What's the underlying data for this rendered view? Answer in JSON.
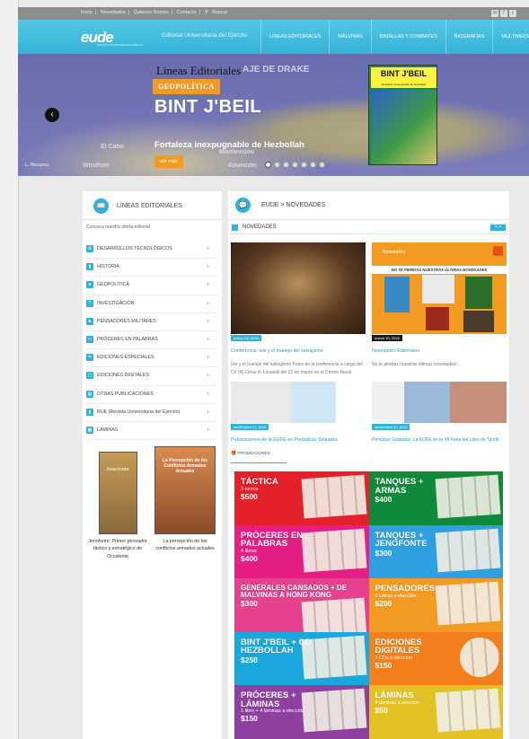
{
  "topbar": {
    "links": [
      "Inicio",
      "|",
      "Novedades",
      "|",
      "Quienes Somos",
      "|",
      "Contacto",
      "|",
      "Buscar"
    ],
    "social": [
      "✉",
      "f",
      "t"
    ]
  },
  "header": {
    "logo_text": "eude",
    "logo_sub": "EDITORIAL UNIVERSITARIA DEL EJÉRCITO",
    "brand": "Editorial Universitaria del Ejército",
    "nav": [
      "LÍNEAS EDITORIALES",
      "MALVINAS",
      "BATALLAS Y COMBATES",
      "BIOGRAFÍAS",
      "MULTIMEDIA"
    ]
  },
  "slider": {
    "heading": "Lineas Editoriales",
    "category": "GEOPOLÍTICA",
    "title": "BINT J'BEIL",
    "subtitle": "Fortaleza inexpugnable de Hezbollah",
    "button": "ver más",
    "map_labels": [
      "AJE DE DRAKE",
      "El Cabo",
      "Montevideo",
      "Asunción",
      "L. Marquez",
      "Windhoe"
    ],
    "cover_title": "BINT J'BEIL",
    "cover_sub": "Fortaleza inexpugnable de Hezbollah",
    "dots": 7,
    "active_dot": 0
  },
  "left": {
    "title": "LÍNEAS EDITORIALES",
    "intro": "Conozca nuestra oferta editorial",
    "items": [
      {
        "label": "DESARROLLOS TECNOLÓGICOS",
        "icon": "⚙"
      },
      {
        "label": "HISTORIA",
        "icon": "▮"
      },
      {
        "label": "GEOPOLÍTICA",
        "icon": "●"
      },
      {
        "label": "INVESTIGACIÓN",
        "icon": "?"
      },
      {
        "label": "PENSADORES MILITARES",
        "icon": "♞"
      },
      {
        "label": "PRÓCERES EN PALABRAS",
        "icon": "▭"
      },
      {
        "label": "EDICIONES ESPECIALES",
        "icon": "✎"
      },
      {
        "label": "EDICIONES DIGITALES",
        "icon": "▢"
      },
      {
        "label": "OTRAS PUBLICACIONES",
        "icon": "▤"
      },
      {
        "label": "RUE (Revista Universitaria del Ejército)",
        "icon": "▮"
      },
      {
        "label": "LÁMINAS",
        "icon": "▦"
      }
    ],
    "books": [
      {
        "cover": "Jenofonte",
        "caption": "Jenofonte: Primer pensador táctico y estratégico de Occidente"
      },
      {
        "cover": "La Percepción de los Conflictos Armados Actuales",
        "caption": "La percepción de los conflictos armados actuales"
      }
    ]
  },
  "right": {
    "title": "EUDE > NOVEDADES",
    "section": "NOVEDADES",
    "news_nav": "< >",
    "cards": [
      {
        "date": "marzo 24, 2016",
        "title": "Conferencia: Isis y el manejo del salvajismo",
        "text": "Isis y el manejo del salvajismo Fotos de la conferencia a cargo del Crl (R) Omar A. Locatelli del 22 de marzo en el Centro Naval."
      },
      {
        "date": "marzo 30, 2016",
        "title": "Novedades Editoriales",
        "text": "No te pierdas nuestras últimas novedades!...",
        "banner": "NO TE PIERDAS NUESTRAS ÚLTIMAS NOVEDADES",
        "banner_small": "Novedades",
        "footer": "UNIVERSITARIA DEL EJÉRCITO ARGENTINO"
      },
      {
        "date": "septiembre 21, 2015",
        "title": "Publicaciones de la EUDE en Periódicos Soldados",
        "text": ""
      },
      {
        "date": "septiembre 21, 2015",
        "title": "Periódico Soldados: La EUDE en la XII Feria del Libro de Tandil",
        "text": ""
      }
    ],
    "promo_tab": "PROMOCIONES",
    "promos": [
      {
        "h": "TÁCTICA",
        "s": "3 tomos",
        "p": "$500",
        "color": "#e4212a"
      },
      {
        "h": "TANQUES + ARMAS",
        "s": "",
        "p": "$400",
        "color": "#0e8a3a"
      },
      {
        "h": "PRÓCERES EN PALABRAS",
        "s": "4 libros",
        "p": "$400",
        "color": "#e61e83"
      },
      {
        "h": "TANQUES + JENOFONTE",
        "s": "",
        "p": "$300",
        "color": "#2e9fe0"
      },
      {
        "h": "GENERALES CANSADOS + DE MALVINAS A HONG KONG",
        "s": "",
        "p": "$300",
        "color": "#e6418c"
      },
      {
        "h": "PENSADORES",
        "s": "2 Libros a elección",
        "p": "$200",
        "color": "#f39a23"
      },
      {
        "h": "BINT J'BEIL + CD HEZBOLLAH",
        "s": "",
        "p": "$250",
        "color": "#19a7dc"
      },
      {
        "h": "EDICIONES DIGITALES",
        "s": "2 CDs a elección",
        "p": "$150",
        "color": "#f07f1c"
      },
      {
        "h": "PRÓCERES + LÁMINAS",
        "s": "1 libro + 4 láminas a elección",
        "p": "$150",
        "color": "#8f3fa0"
      },
      {
        "h": "LÁMINAS",
        "s": "4 láminas a elección",
        "p": "$50",
        "color": "#e2c124"
      }
    ]
  }
}
